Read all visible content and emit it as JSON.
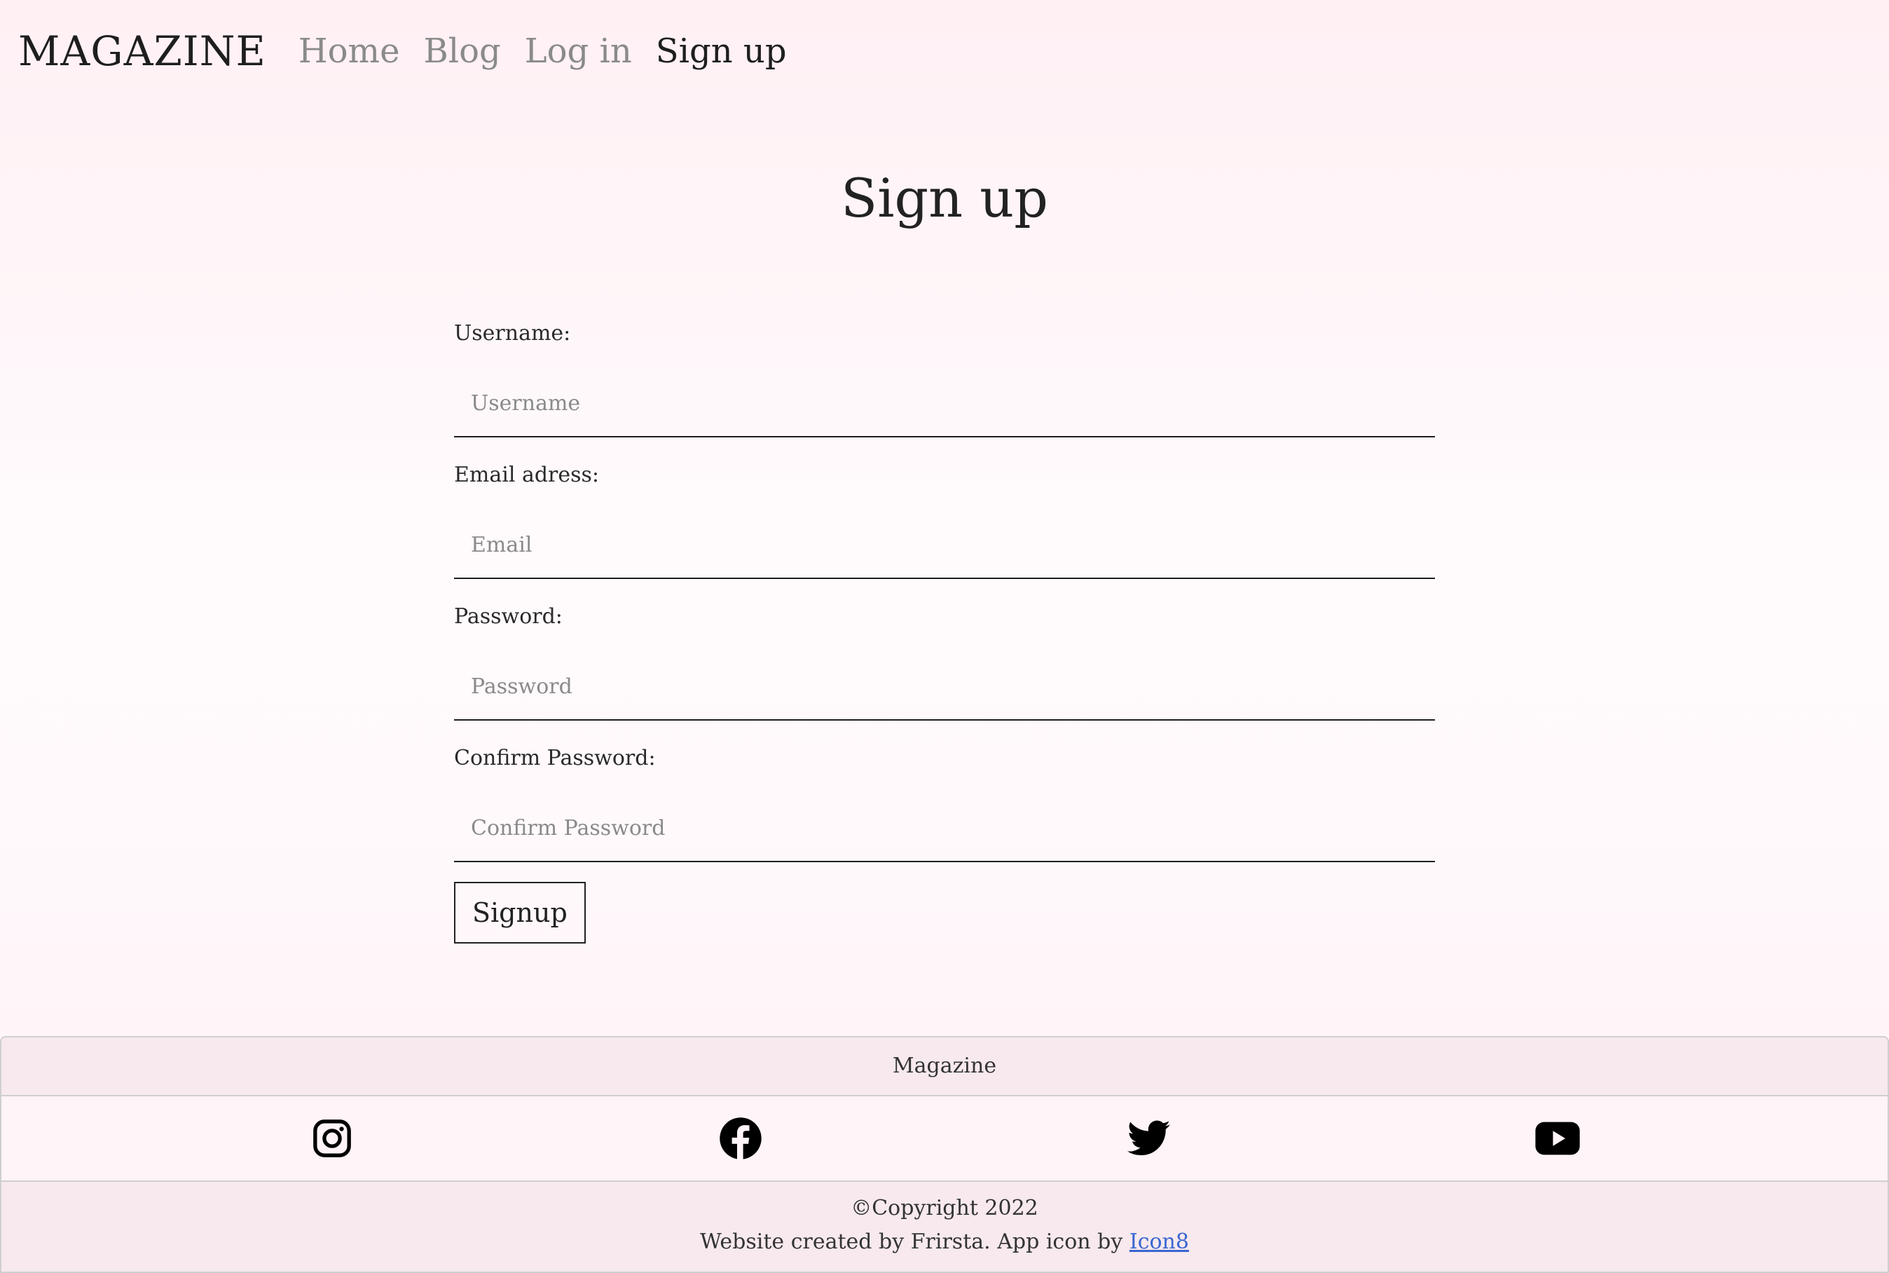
{
  "nav": {
    "brand": "MAGAZINE",
    "links": [
      "Home",
      "Blog",
      "Log in",
      "Sign up"
    ],
    "active": "Sign up"
  },
  "page": {
    "title": "Sign up"
  },
  "form": {
    "username": {
      "label": "Username:",
      "placeholder": "Username",
      "value": ""
    },
    "email": {
      "label": "Email adress:",
      "placeholder": "Email",
      "value": ""
    },
    "password": {
      "label": "Password:",
      "placeholder": "Password",
      "value": ""
    },
    "confirm": {
      "label": "Confirm Password:",
      "placeholder": "Confirm Password",
      "value": ""
    },
    "submit_label": "Signup"
  },
  "footer": {
    "title": "Magazine",
    "icons": [
      "instagram-icon",
      "facebook-icon",
      "twitter-icon",
      "youtube-icon"
    ],
    "copyright": "©Copyright 2022",
    "credit_prefix": "Website created by Frirsta. App icon by ",
    "credit_link": "Icon8"
  },
  "colors": {
    "link": "#3a66d1",
    "muted_nav": "#8a8a8a",
    "footer_bg": "#f7e9ee"
  }
}
